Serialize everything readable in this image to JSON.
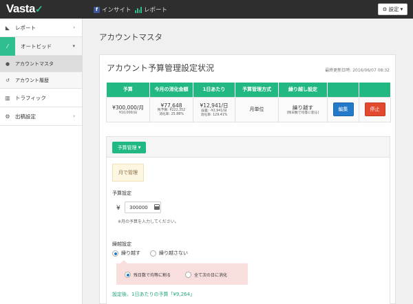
{
  "app": {
    "logo": "Vasta",
    "logo_mark": "✓"
  },
  "topnav": {
    "insight": "インサイト",
    "report": "レポート",
    "settings": "設定"
  },
  "sidebar": {
    "report": "レポート",
    "autobid": "オートビッド",
    "account_master": "アカウントマスタ",
    "account_history": "アカウント履歴",
    "traffic": "トラフィック",
    "ad_settings": "出稿設定"
  },
  "page": {
    "title": "アカウントマスタ"
  },
  "panel": {
    "title": "アカウント予算管理設定状況",
    "updated": "最終更新日時: 2016/06/07 08:32"
  },
  "table": {
    "headers": [
      "予算",
      "今月の消化金額",
      "1日あたり",
      "予算管理方式",
      "繰り越し設定",
      "",
      ""
    ],
    "row": {
      "budget_main": "¥300,000/月",
      "budget_sub": "¥10,000/日",
      "spent_main": "¥77,648",
      "spent_sub1": "残予算: ¥222,352",
      "spent_sub2": "消化率: 25.88%",
      "daily_main": "¥12,941/日",
      "daily_sub1": "誤差: -¥2,941/日",
      "daily_sub2": "消化率: 129.41%",
      "method": "月単位",
      "carry_main": "繰り越す",
      "carry_sub": "(残日数で均等に割る)",
      "edit": "編集",
      "stop": "停止"
    }
  },
  "form": {
    "dropdown": "予算管理",
    "mode": "月で管理",
    "budget_label": "予算設定",
    "yen": "¥",
    "budget_value": "300000",
    "hint": "※月の予算を入力してください。",
    "carry_label": "繰越設定",
    "carry_yes": "繰り越す",
    "carry_no": "繰り越さない",
    "split_even": "残日数で均等に割る",
    "split_next": "全て次の日に消化",
    "result": "設定後、1日あたりの予算「¥9,264」"
  },
  "colors": {
    "accent": "#21b882",
    "topbar": "#2e2e2e",
    "edit": "#2479c9",
    "stop": "#e2492f"
  }
}
